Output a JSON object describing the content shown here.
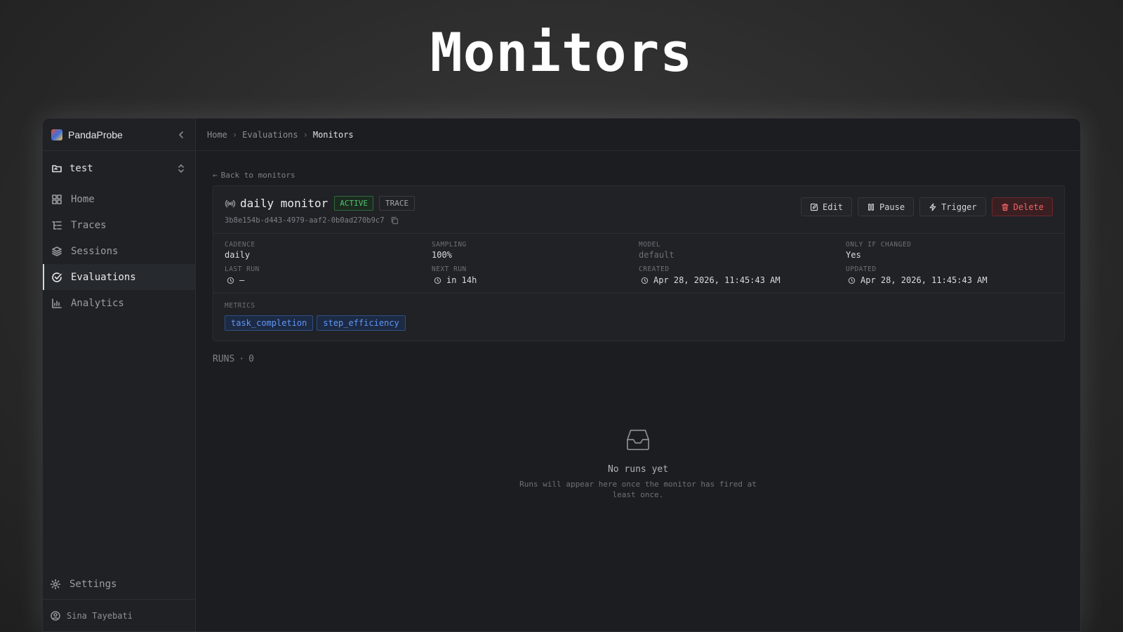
{
  "hero": {
    "title": "Monitors"
  },
  "sidebar": {
    "brand": "PandaProbe",
    "project": "test",
    "items": [
      {
        "label": "Home",
        "icon": "grid-icon",
        "active": false
      },
      {
        "label": "Traces",
        "icon": "list-tree-icon",
        "active": false
      },
      {
        "label": "Sessions",
        "icon": "layers-icon",
        "active": false
      },
      {
        "label": "Evaluations",
        "icon": "check-circle-icon",
        "active": true
      },
      {
        "label": "Analytics",
        "icon": "bar-chart-icon",
        "active": false
      }
    ],
    "settings": "Settings",
    "user": "Sina Tayebati"
  },
  "breadcrumb": {
    "home": "Home",
    "evaluations": "Evaluations",
    "current": "Monitors"
  },
  "back_link": "Back to monitors",
  "monitor": {
    "name": "daily monitor",
    "status": "ACTIVE",
    "scope": "TRACE",
    "id": "3b8e154b-d443-4979-aaf2-0b0ad270b9c7",
    "actions": {
      "edit": "Edit",
      "pause": "Pause",
      "trigger": "Trigger",
      "delete": "Delete"
    },
    "fields": {
      "cadence": {
        "label": "CADENCE",
        "value": "daily"
      },
      "sampling": {
        "label": "SAMPLING",
        "value": "100%"
      },
      "model": {
        "label": "MODEL",
        "value": "default"
      },
      "only_if_changed": {
        "label": "ONLY IF CHANGED",
        "value": "Yes"
      },
      "last_run": {
        "label": "LAST RUN",
        "value": "—"
      },
      "next_run": {
        "label": "NEXT RUN",
        "value": "in 14h"
      },
      "created": {
        "label": "CREATED",
        "value": "Apr 28, 2026, 11:45:43 AM"
      },
      "updated": {
        "label": "UPDATED",
        "value": "Apr 28, 2026, 11:45:43 AM"
      }
    },
    "metrics_label": "METRICS",
    "metrics": [
      "task_completion",
      "step_efficiency"
    ]
  },
  "runs": {
    "label": "RUNS",
    "count": "0"
  },
  "empty_state": {
    "title": "No runs yet",
    "description": "Runs will appear here once the monitor has fired at least once."
  },
  "colors": {
    "accent_green": "#4fc26c",
    "danger": "#f06464",
    "tag_blue": "#5f97f5"
  }
}
